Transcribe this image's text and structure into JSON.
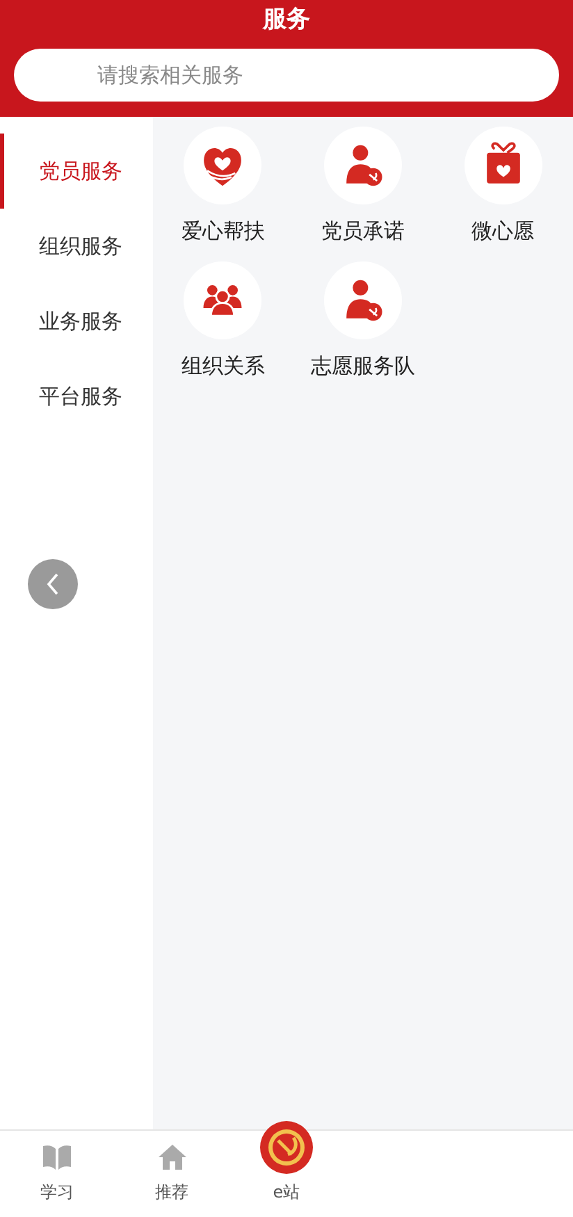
{
  "header": {
    "title": "服务"
  },
  "search": {
    "placeholder": "请搜索相关服务"
  },
  "sidebar": {
    "items": [
      {
        "label": "党员服务",
        "selected": true
      },
      {
        "label": "组织服务",
        "selected": false
      },
      {
        "label": "业务服务",
        "selected": false
      },
      {
        "label": "平台服务",
        "selected": false
      }
    ]
  },
  "services": [
    {
      "kind": "heart-hand",
      "label": "爱心帮扶"
    },
    {
      "kind": "member",
      "label": "党员承诺"
    },
    {
      "kind": "gift",
      "label": "微心愿"
    },
    {
      "kind": "group",
      "label": "组织关系"
    },
    {
      "kind": "member",
      "label": "志愿服务队"
    }
  ],
  "bottom_nav": [
    {
      "kind": "book",
      "label": "学习"
    },
    {
      "kind": "home",
      "label": "推荐"
    },
    {
      "kind": "emblem",
      "label": "e站"
    }
  ]
}
